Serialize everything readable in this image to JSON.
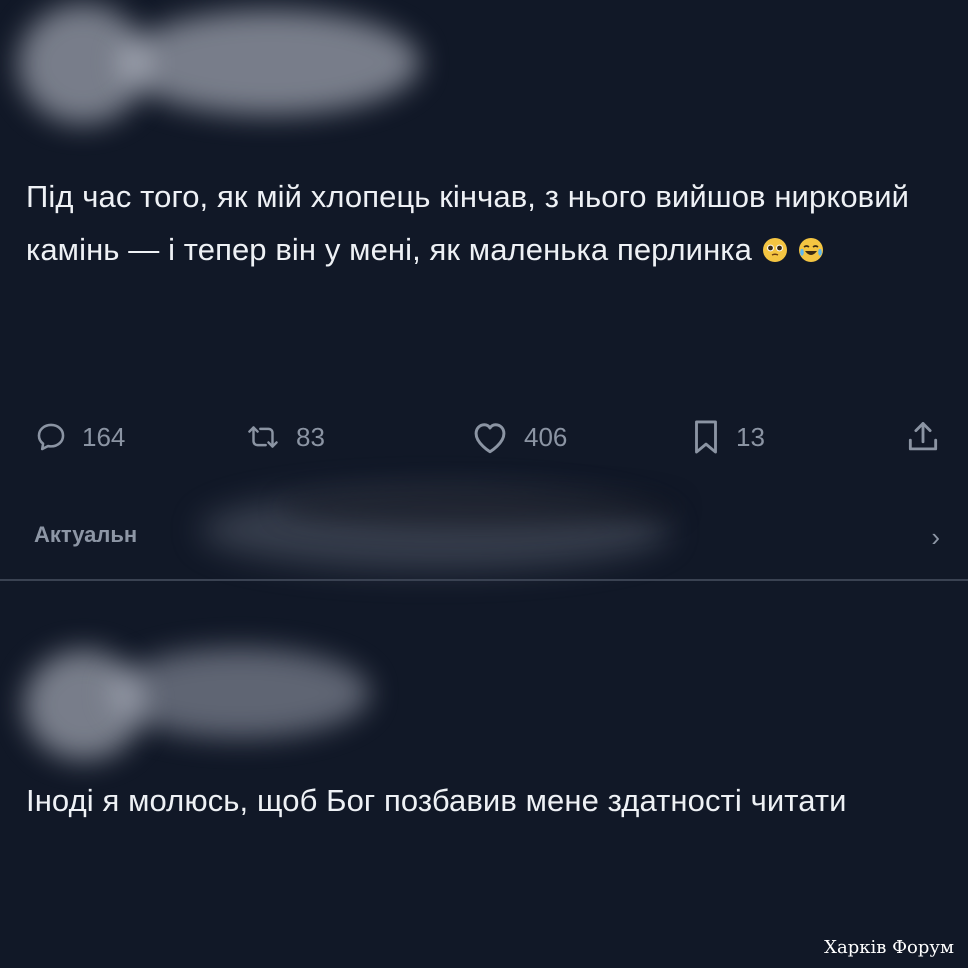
{
  "post1": {
    "text": "Під час того, як мій хлопець кінчав, з нього вийшов нирковий камінь — і тепер він у мені, як маленька перлинка",
    "emojis": [
      "pleading-face-icon",
      "tears-of-joy-icon"
    ]
  },
  "actions": {
    "replies": "164",
    "reposts": "83",
    "likes": "406",
    "bookmarks": "13"
  },
  "section": {
    "label": "Актуальн"
  },
  "post2": {
    "text": "Іноді я молюсь, щоб Бог позбавив мене здатності читати"
  },
  "watermark": "Харків Форум",
  "colors": {
    "background": "#111827",
    "text": "#eef1f5",
    "muted": "#8b94a3"
  }
}
